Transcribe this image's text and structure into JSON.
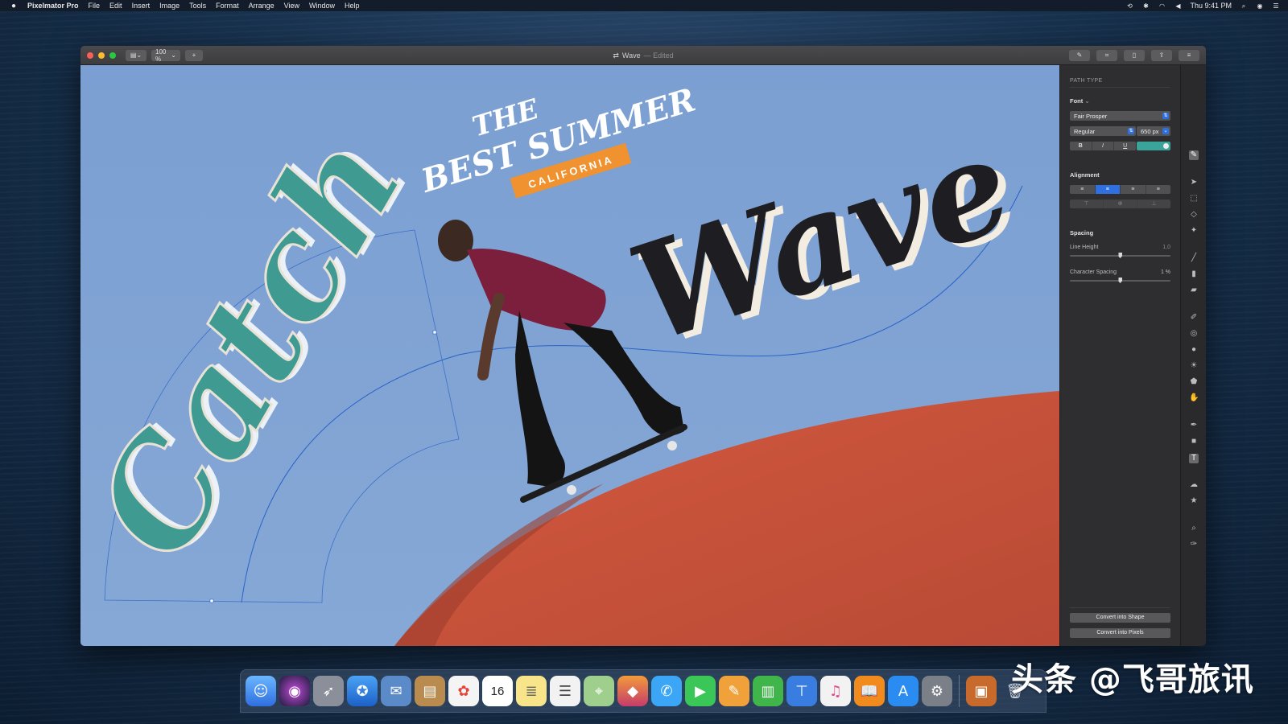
{
  "menubar": {
    "app_name": "Pixelmator Pro",
    "menus": [
      "File",
      "Edit",
      "Insert",
      "Image",
      "Tools",
      "Format",
      "Arrange",
      "View",
      "Window",
      "Help"
    ],
    "clock": "Thu 9:41 PM"
  },
  "window": {
    "title": "Wave",
    "edited": "— Edited",
    "zoom": "100 %"
  },
  "artwork": {
    "headline_the": "THE",
    "headline_best": "BEST SUMMER",
    "ribbon": "CALIFORNIA",
    "word_catch": "Catch",
    "word_wave": "Wave"
  },
  "sidebar": {
    "path_type": "PATH TYPE",
    "font_label": "Font",
    "font_label_suffix": "⌄",
    "font_family": "Fair Prosper",
    "font_style": "Regular",
    "font_size": "650 px",
    "format_buttons": [
      "B",
      "I",
      "U"
    ],
    "text_color": "#3aa39a",
    "alignment_label": "Alignment",
    "align_options": [
      "≡",
      "≡",
      "≡",
      "≡"
    ],
    "valign_options": [
      "⊤",
      "⊕",
      "⊥"
    ],
    "spacing_label": "Spacing",
    "line_height_label": "Line Height",
    "line_height_value": "1,0",
    "line_height_level": 0.5,
    "char_spacing_label": "Character Spacing",
    "char_spacing_value": "1 %",
    "char_spacing_level": 0.5,
    "convert_shape": "Convert into Shape",
    "convert_pixels": "Convert into Pixels"
  },
  "colors": {
    "canvas_sky": "#7a9fd0",
    "dome": "#c9533d",
    "catch_fill": "#3f9a92",
    "wave_fill": "#1e1e22",
    "ribbon": "#f0922f",
    "accent": "#2f6fe0"
  },
  "dock": {
    "icons": [
      "finder-icon",
      "siri-icon",
      "launchpad-icon",
      "safari-icon",
      "mail-icon",
      "contacts-icon",
      "photos-icon",
      "calendar-icon",
      "notes-icon",
      "reminders-icon",
      "maps-icon",
      "pixelmator-icon",
      "messages-icon",
      "facetime-icon",
      "pages-icon",
      "numbers-icon",
      "keynote-icon",
      "itunes-icon",
      "books-icon",
      "appstore-icon",
      "system-preferences-icon"
    ],
    "calendar_day": "16"
  },
  "watermark": "头条 @飞哥旅讯"
}
